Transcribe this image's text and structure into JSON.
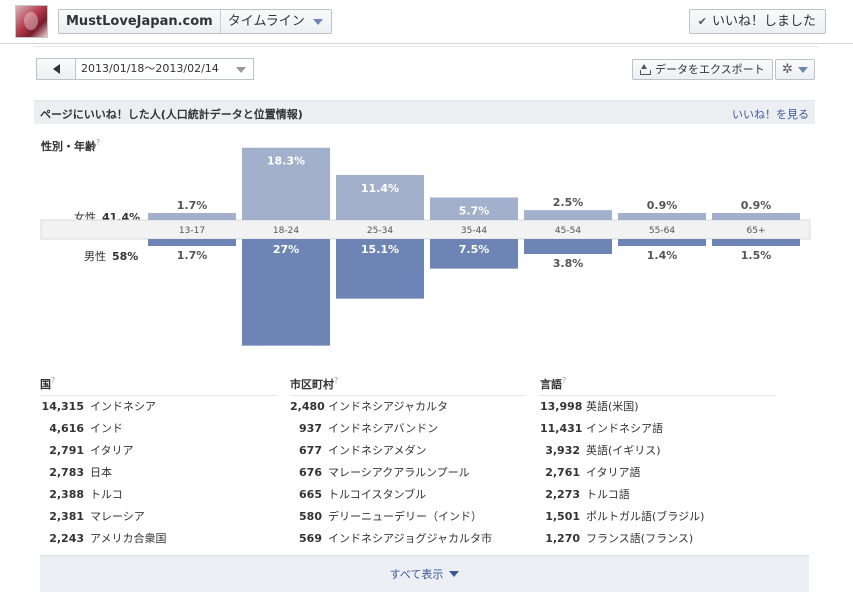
{
  "header": {
    "page_name": "MustLoveJapan.com",
    "timeline_label": "タイムライン",
    "liked_label": "いいね！しました"
  },
  "toolbar": {
    "date_range": "2013/01/18～2013/02/14",
    "export_label": "データをエクスポート"
  },
  "section": {
    "title": "ページにいいね！した人(人口統計データと位置情報)",
    "see_likes": "いいね！を見る"
  },
  "gender_age": {
    "label": "性別・年齢",
    "female_label": "女性",
    "female_pct": "41.4%",
    "male_label": "男性",
    "male_pct": "58%"
  },
  "chart_data": {
    "type": "bar",
    "categories": [
      "13-17",
      "18-24",
      "25-34",
      "35-44",
      "45-54",
      "55-64",
      "65+"
    ],
    "series": [
      {
        "name": "女性",
        "values": [
          1.7,
          18.3,
          11.4,
          5.7,
          2.5,
          0.9,
          0.9
        ],
        "labels": [
          "1.7%",
          "18.3%",
          "11.4%",
          "5.7%",
          "2.5%",
          "0.9%",
          "0.9%"
        ],
        "color": "#a3b0cc"
      },
      {
        "name": "男性",
        "values": [
          1.7,
          27,
          15.1,
          7.5,
          3.8,
          1.4,
          1.5
        ],
        "labels": [
          "1.7%",
          "27%",
          "15.1%",
          "7.5%",
          "3.8%",
          "1.4%",
          "1.5%"
        ],
        "color": "#6d84b4"
      }
    ],
    "title": "",
    "xlabel": "",
    "ylabel": ""
  },
  "lists": {
    "country": {
      "header": "国",
      "rows": [
        {
          "num": "14,315",
          "label": "インドネシア"
        },
        {
          "num": "4,616",
          "label": "インド"
        },
        {
          "num": "2,791",
          "label": "イタリア"
        },
        {
          "num": "2,783",
          "label": "日本"
        },
        {
          "num": "2,388",
          "label": "トルコ"
        },
        {
          "num": "2,381",
          "label": "マレーシア"
        },
        {
          "num": "2,243",
          "label": "アメリカ合衆国"
        }
      ]
    },
    "city": {
      "header": "市区町村",
      "rows": [
        {
          "num": "2,480",
          "label": "インドネシアジャカルタ"
        },
        {
          "num": "937",
          "label": "インドネシアバンドン"
        },
        {
          "num": "677",
          "label": "インドネシアメダン"
        },
        {
          "num": "676",
          "label": "マレーシアクアラルンプール"
        },
        {
          "num": "665",
          "label": "トルコイスタンブル"
        },
        {
          "num": "580",
          "label": "デリーニューデリー（インド）"
        },
        {
          "num": "569",
          "label": "インドネシアジョグジャカルタ市"
        }
      ]
    },
    "language": {
      "header": "言語",
      "rows": [
        {
          "num": "13,998",
          "label": "英語(米国)"
        },
        {
          "num": "11,431",
          "label": "インドネシア語"
        },
        {
          "num": "3,932",
          "label": "英語(イギリス)"
        },
        {
          "num": "2,761",
          "label": "イタリア語"
        },
        {
          "num": "2,273",
          "label": "トルコ語"
        },
        {
          "num": "1,501",
          "label": "ポルトガル語(ブラジル)"
        },
        {
          "num": "1,270",
          "label": "フランス語(フランス)"
        }
      ]
    }
  },
  "show_all_label": "すべて表示"
}
